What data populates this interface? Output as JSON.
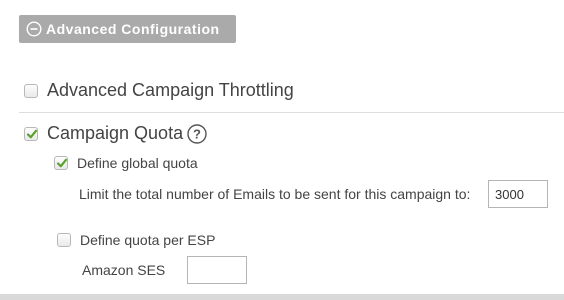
{
  "header": {
    "advanced_button_label": "Advanced Configuration",
    "icon": "minus-circle-icon"
  },
  "options": {
    "throttling": {
      "label": "Advanced Campaign Throttling",
      "checked": false
    },
    "quota": {
      "label": "Campaign Quota",
      "checked": true,
      "help_icon": "question-circle-icon",
      "help_glyph": "?"
    },
    "global_quota": {
      "label": "Define global quota",
      "checked": true,
      "limit_text": "Limit the total number of Emails to be sent for this campaign to:",
      "limit_value": "3000"
    },
    "esp_quota": {
      "label": "Define quota per ESP",
      "checked": false,
      "providers": [
        {
          "name": "Amazon SES",
          "value": ""
        }
      ]
    }
  },
  "colors": {
    "button_bg": "#aaaaaa",
    "check_green": "#5aa02c",
    "text": "#444444",
    "divider": "#dddddd"
  }
}
